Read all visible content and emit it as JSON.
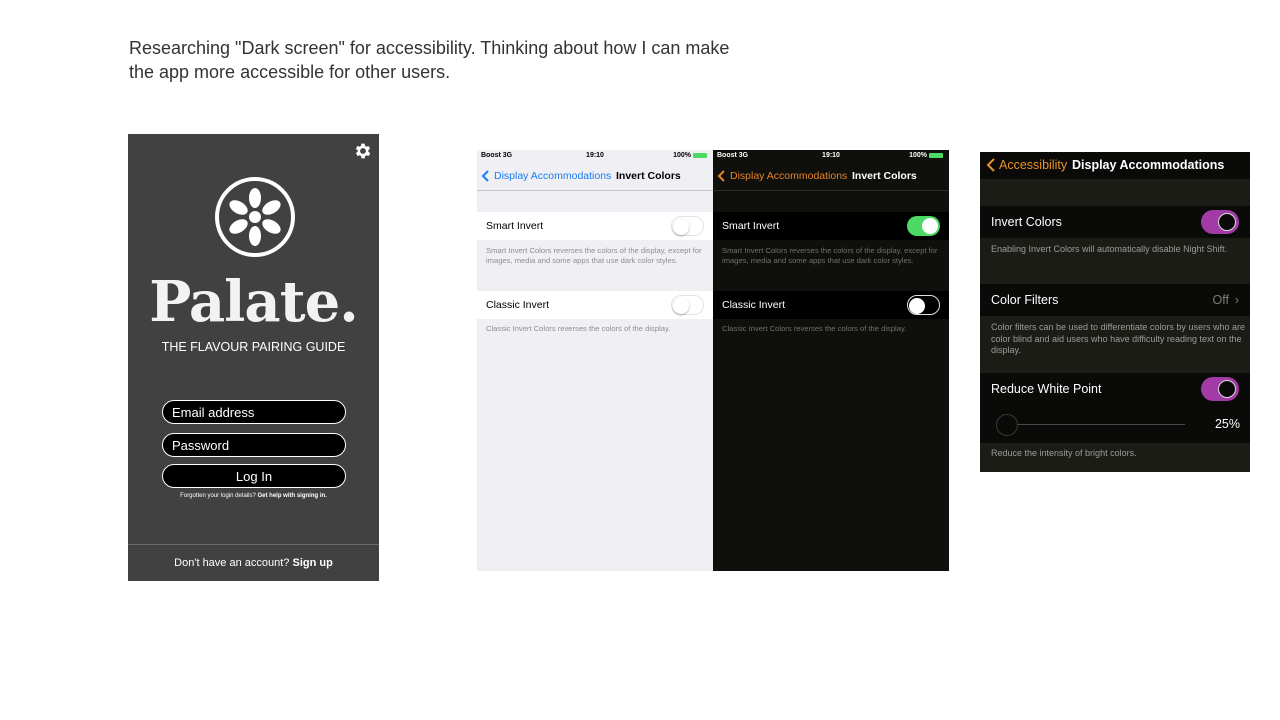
{
  "note": {
    "line1": "Researching \"Dark screen\" for accessibility. Thinking about how I can make",
    "line2": "the app more accessible for other users."
  },
  "palate": {
    "brand": "Palate.",
    "tagline": "THE FLAVOUR PAIRING GUIDE",
    "email_placeholder": "Email address",
    "password_placeholder": "Password",
    "login_label": "Log In",
    "forgot_text": "Forgotten your login details?",
    "forgot_link": "Get help with signing in.",
    "signup_text": "Don't have an account?",
    "signup_link": "Sign up",
    "icons": [
      "gear-icon",
      "lemon-logo-icon"
    ]
  },
  "ios_light": {
    "carrier": "Boost  3G",
    "time": "19:10",
    "battery": "100%",
    "back_label": "Display Accommodations",
    "title": "Invert Colors",
    "smart_invert": "Smart Invert",
    "smart_note": "Smart Invert Colors reverses the colors of the display, except for images, media and some apps that use dark color styles.",
    "smart_on": false,
    "classic_invert": "Classic Invert",
    "classic_note": "Classic Invert Colors reverses the colors of the display.",
    "classic_on": false,
    "colors": {
      "accent": "#1a7cf5",
      "bg": "#efeff4"
    }
  },
  "ios_dark": {
    "carrier": "Boost  3G",
    "time": "19:10",
    "battery": "100%",
    "back_label": "Display Accommodations",
    "title": "Invert Colors",
    "smart_invert": "Smart Invert",
    "smart_note": "Smart Invert Colors reverses the colors of the display, except for images, media and some apps that use dark color styles.",
    "smart_on": true,
    "classic_invert": "Classic Invert",
    "classic_note": "Classic Invert Colors reverses the colors of the display.",
    "classic_on": false,
    "colors": {
      "accent": "#e5832a",
      "toggle_on": "#4cd964",
      "bg": "#0f0f0b"
    }
  },
  "display_accommodations": {
    "back_label": "Accessibility",
    "title": "Display Accommodations",
    "invert_colors": "Invert Colors",
    "invert_on": true,
    "invert_note": "Enabling Invert Colors will automatically disable Night Shift.",
    "color_filters": "Color Filters",
    "color_filters_value": "Off",
    "color_filters_note": "Color filters can be used to differentiate colors by users who are color blind and aid users who have difficulty reading text on the display.",
    "reduce_white_point": "Reduce White Point",
    "reduce_on": true,
    "reduce_percent": "25%",
    "reduce_note": "Reduce the intensity of bright colors.",
    "colors": {
      "accent": "#e8932a",
      "toggle_on": "#a23ba6"
    }
  }
}
